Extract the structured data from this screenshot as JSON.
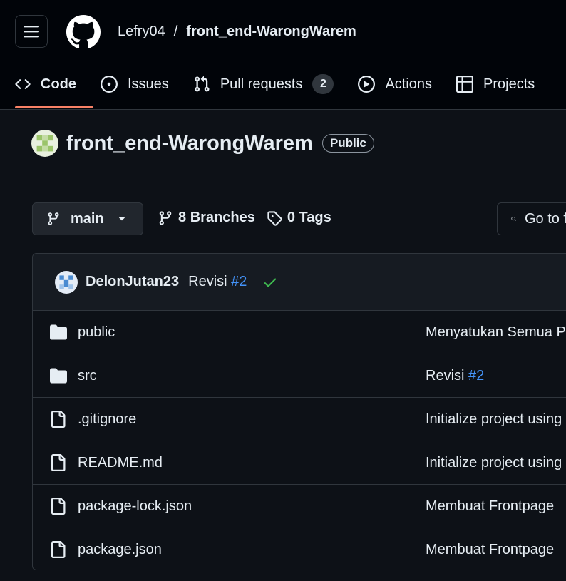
{
  "header": {
    "owner": "Lefry04",
    "separator": "/",
    "repo": "front_end-WarongWarem"
  },
  "tabs": [
    {
      "label": "Code",
      "icon": "code-icon"
    },
    {
      "label": "Issues",
      "icon": "issue-icon"
    },
    {
      "label": "Pull requests",
      "icon": "pull-request-icon",
      "count": "2"
    },
    {
      "label": "Actions",
      "icon": "play-icon"
    },
    {
      "label": "Projects",
      "icon": "table-icon"
    }
  ],
  "repo": {
    "name": "front_end-WarongWarem",
    "visibility": "Public"
  },
  "toolbar": {
    "branch": "main",
    "branches_count": "8",
    "branches_label": "Branches",
    "tags_count": "0",
    "tags_label": "Tags",
    "goto_label": "Go to file"
  },
  "commit": {
    "author": "DelonJutan23",
    "message": "Revisi",
    "ref": "#2",
    "status": "success"
  },
  "files": [
    {
      "type": "folder",
      "name": "public",
      "message": "Menyatukan Semua Page",
      "ref": ""
    },
    {
      "type": "folder",
      "name": "src",
      "message": "Revisi",
      "ref": "#2"
    },
    {
      "type": "file",
      "name": ".gitignore",
      "message": "Initialize project using Create React App",
      "ref": ""
    },
    {
      "type": "file",
      "name": "README.md",
      "message": "Initialize project using Create React App",
      "ref": ""
    },
    {
      "type": "file",
      "name": "package-lock.json",
      "message": "Membuat Frontpage",
      "ref": ""
    },
    {
      "type": "file",
      "name": "package.json",
      "message": "Membuat Frontpage",
      "ref": ""
    }
  ],
  "colors": {
    "background": "#0d1117",
    "header": "#010409",
    "accent_underline": "#f78166",
    "link": "#4493f8",
    "success": "#3fb950"
  }
}
